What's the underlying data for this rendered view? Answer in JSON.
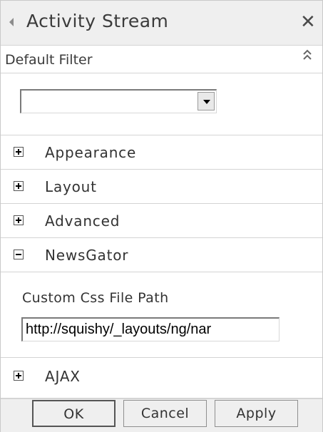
{
  "title_bar": {
    "title": "Activity Stream",
    "close_icon": "close-icon",
    "back_icon": "left-arrow-icon"
  },
  "default_filter": {
    "label": "Default Filter",
    "collapse_icon": "double-chevron-up-icon",
    "selected_value": ""
  },
  "sections": [
    {
      "label": "Appearance",
      "expanded": false
    },
    {
      "label": "Layout",
      "expanded": false
    },
    {
      "label": "Advanced",
      "expanded": false
    },
    {
      "label": "NewsGator",
      "expanded": true
    },
    {
      "label": "AJAX",
      "expanded": false
    }
  ],
  "newsgator": {
    "custom_css_label": "Custom Css File Path",
    "custom_css_value": "http://squishy/_layouts/ng/nar"
  },
  "footer": {
    "ok_label": "OK",
    "cancel_label": "Cancel",
    "apply_label": "Apply"
  }
}
